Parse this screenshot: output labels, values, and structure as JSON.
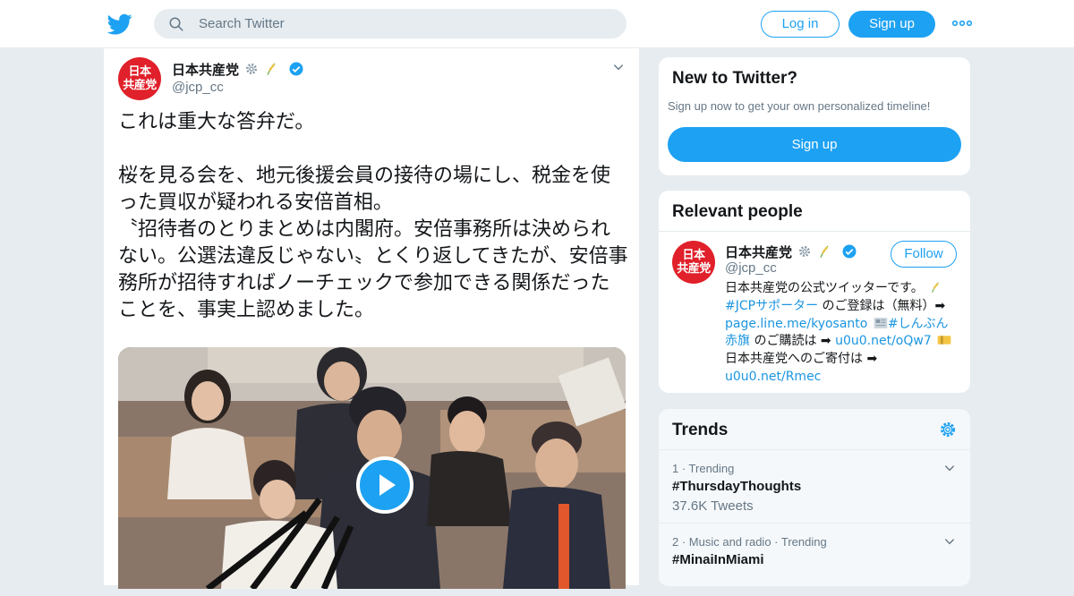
{
  "header": {
    "search_placeholder": "Search Twitter",
    "login_label": "Log in",
    "signup_label": "Sign up"
  },
  "tweet": {
    "avatar_text_line1": "日本",
    "avatar_text_line2": "共産党",
    "display_name": "日本共産党",
    "handle": "@jcp_cc",
    "text": "これは重大な答弁だ。\n\n桜を見る会を、地元後援会員の接待の場にし、税金を使った買収が疑われる安倍首相。\n〝招待者のとりまとめは内閣府。安倍事務所は決められない。公選法違反じゃない〟とくり返してきたが、安倍事務所が招待すればノーチェックで参加できる関係だったことを、事実上認めました。"
  },
  "sidebar": {
    "new_to_twitter": {
      "title": "New to Twitter?",
      "subtitle": "Sign up now to get your own personalized timeline!",
      "signup_label": "Sign up"
    },
    "relevant_people": {
      "title": "Relevant people",
      "person": {
        "display_name": "日本共産党",
        "handle": "@jcp_cc",
        "follow_label": "Follow",
        "bio_part1": "日本共産党の公式ツイッターです。",
        "bio_hashtag1": "#JCPサポーター",
        "bio_part2": " のご登録は（無料）➡ ",
        "bio_link1": "page.line.me/kyosanto",
        "bio_hashtag2": "#しんぶん赤旗",
        "bio_part3": " のご購読は ➡ ",
        "bio_link2": "u0u0.net/oQw7",
        "bio_part4": "日本共産党へのご寄付は ➡ ",
        "bio_link3": "u0u0.net/Rmec"
      }
    },
    "trends": {
      "title": "Trends",
      "items": [
        {
          "meta": "1 · Trending",
          "name": "#ThursdayThoughts",
          "count": "37.6K Tweets"
        },
        {
          "meta": "2 · Music and radio · Trending",
          "name": "#MinaiInMiami",
          "count": ""
        }
      ]
    }
  },
  "colors": {
    "brand_blue": "#1da1f2",
    "jcp_red": "#e0202a"
  }
}
